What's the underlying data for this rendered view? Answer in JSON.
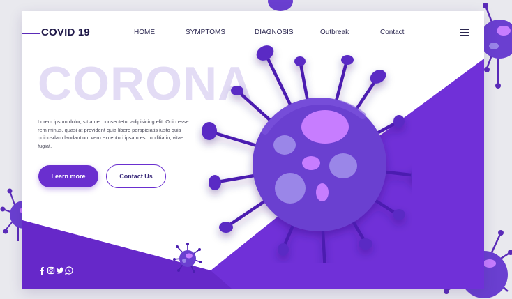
{
  "brand": {
    "name": "COVID 19"
  },
  "nav": {
    "items": [
      {
        "label": "HOME"
      },
      {
        "label": "SYMPTOMS"
      },
      {
        "label": "DIAGNOSIS"
      },
      {
        "label": "Outbreak"
      },
      {
        "label": "Contact"
      }
    ],
    "menu_icon": "hamburger-menu-icon"
  },
  "hero": {
    "title": "CORONA",
    "body": "Lorem ipsum dolor, sit amet consectetur adipisicing elit. Odio esse rem minus, quasi at provident quia libero perspiciatis iusto quis quibusdam laudantium vero excepturi ipsam est mollitia in, vitae fugiat.",
    "primary_button": "Learn more",
    "secondary_button": "Contact Us"
  },
  "social": {
    "icons": [
      "facebook-icon",
      "instagram-icon",
      "twitter-icon",
      "whatsapp-icon"
    ]
  },
  "colors": {
    "accent": "#6a2fcf",
    "accent_dark": "#5a2bb8",
    "title_watermark": "#e3dcf5",
    "virus_body": "#6a3fd0",
    "virus_spot": "#c77dff"
  }
}
